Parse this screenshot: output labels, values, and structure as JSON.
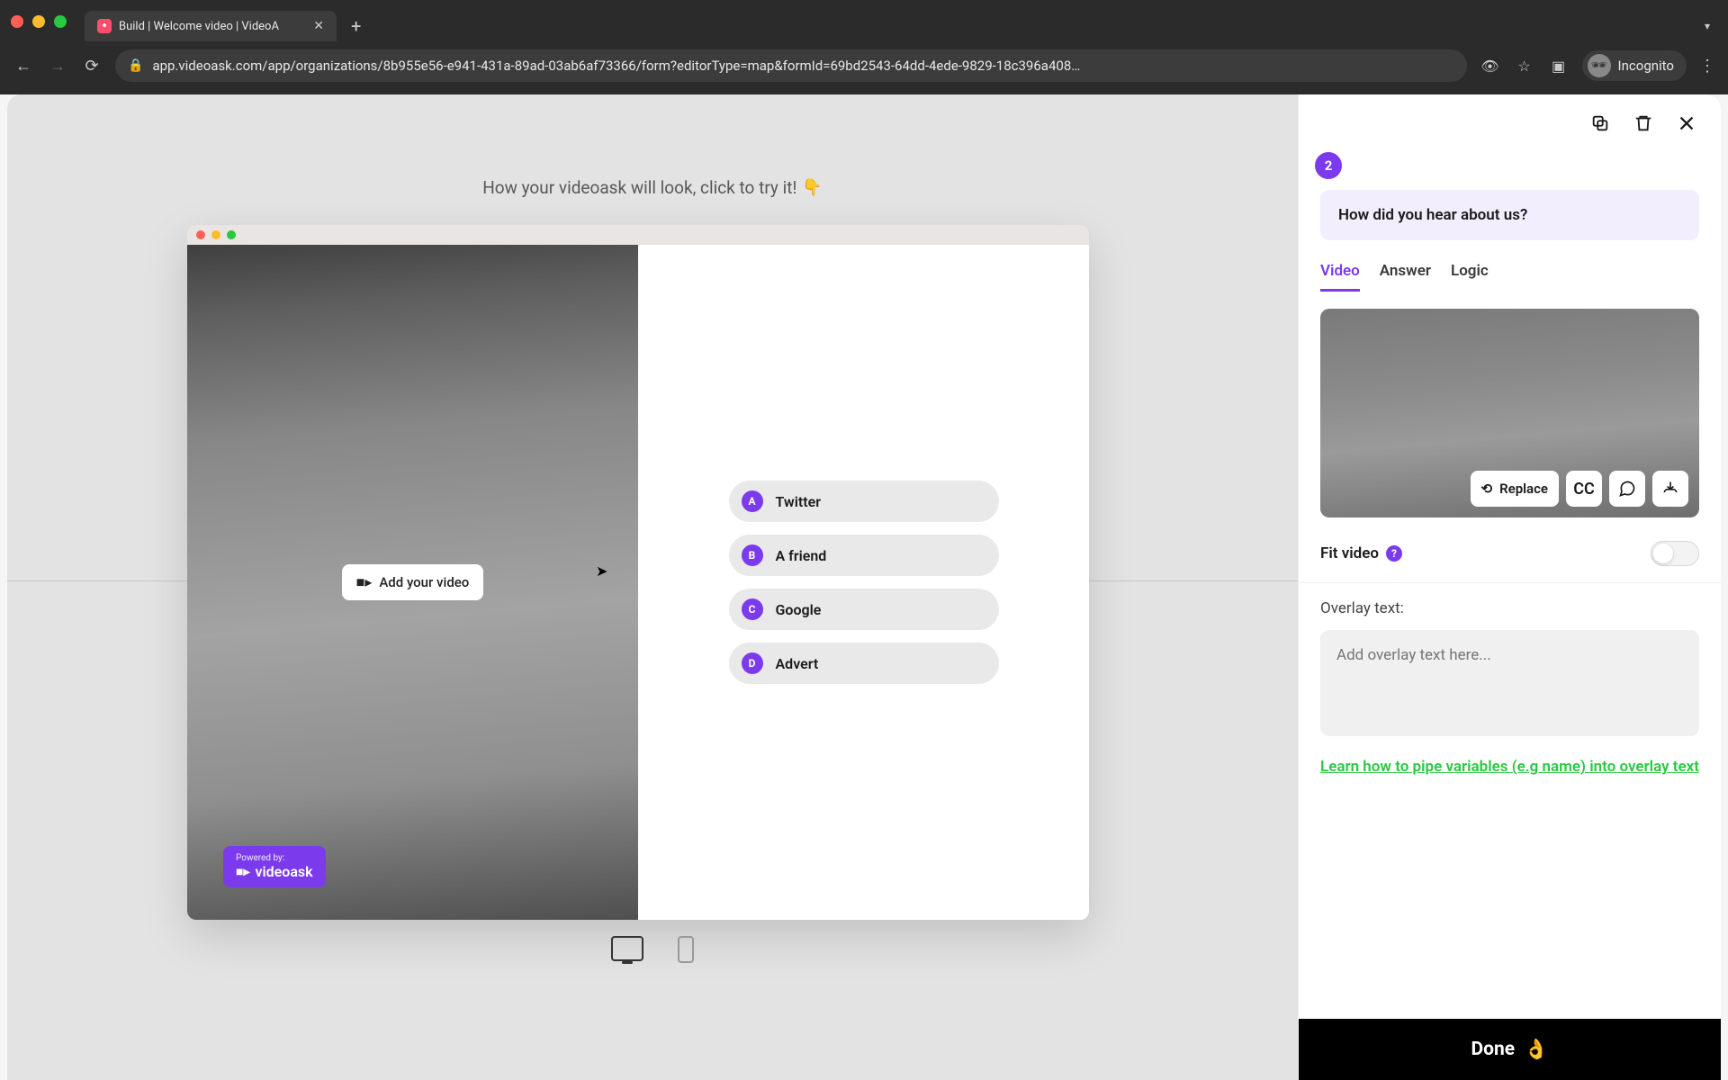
{
  "browser": {
    "tab_title": "Build | Welcome video | VideoA",
    "url": "app.videoask.com/app/organizations/8b955e56-e941-431a-89ad-03ab6af73366/form?editorType=map&formId=69bd2543-64dd-4ede-9829-18c396a408…",
    "incognito_label": "Incognito"
  },
  "canvas": {
    "hint_text": "How your videoask will look, click to try it!",
    "hint_emoji": "👇",
    "add_video_label": "Add your video",
    "powered_top": "Powered by:",
    "powered_name": "videoask"
  },
  "answers": [
    {
      "letter": "A",
      "text": "Twitter"
    },
    {
      "letter": "B",
      "text": "A friend"
    },
    {
      "letter": "C",
      "text": "Google"
    },
    {
      "letter": "D",
      "text": "Advert"
    }
  ],
  "sidebar": {
    "step_number": "2",
    "question": "How did you hear about us?",
    "tabs": {
      "video": "Video",
      "answer": "Answer",
      "logic": "Logic"
    },
    "replace_label": "Replace",
    "cc_label": "CC",
    "fit_video_label": "Fit video",
    "overlay_label": "Overlay text:",
    "overlay_placeholder": "Add overlay text here...",
    "learn_link": "Learn how to pipe variables (e.g name) into overlay text",
    "done_label": "Done",
    "done_emoji": "👌"
  }
}
